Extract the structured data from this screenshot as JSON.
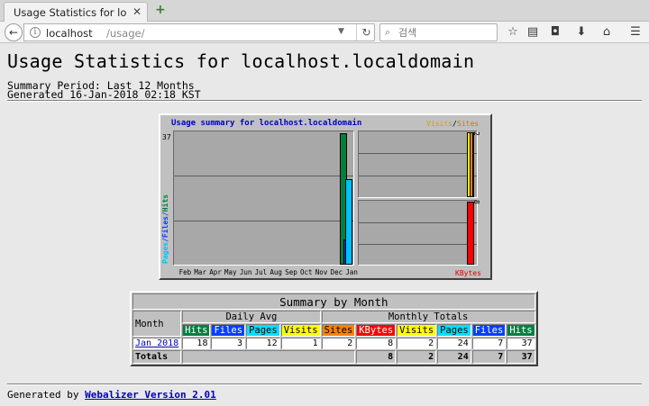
{
  "browser": {
    "tab_title": "Usage Statistics for loc",
    "tab_close": "✕",
    "new_tab": "+",
    "url_host": "localhost",
    "url_path": "/usage/",
    "search_placeholder": "검색"
  },
  "page": {
    "title": "Usage Statistics for localhost.localdomain",
    "summary_period": "Summary Period: Last 12 Months",
    "generated": "Generated 16-Jan-2018 02:18 KST"
  },
  "graph": {
    "title": "Usage summary for localhost.localdomain",
    "legend_visits": "Visits",
    "legend_slash": "/",
    "legend_sites": "Sites",
    "ylabel_pages": "Pages",
    "ylabel_files": "/Files/",
    "ylabel_hits": "Hits",
    "ymax_main": "37",
    "ymax_visits_sites": "2",
    "ymax_kbytes": "8",
    "kbytes_label": "KBytes",
    "months": [
      "Feb",
      "Mar",
      "Apr",
      "May",
      "Jun",
      "Jul",
      "Aug",
      "Sep",
      "Oct",
      "Nov",
      "Dec",
      "Jan"
    ],
    "colors": {
      "hits": "#008040",
      "files": "#0040ff",
      "pages": "#00c0ff",
      "visits": "#ffff00",
      "sites": "#ff8000",
      "kbytes": "#ff0000"
    }
  },
  "chart_data": {
    "type": "bar",
    "categories": [
      "Feb",
      "Mar",
      "Apr",
      "May",
      "Jun",
      "Jul",
      "Aug",
      "Sep",
      "Oct",
      "Nov",
      "Dec",
      "Jan"
    ],
    "series": [
      {
        "name": "Hits",
        "values": [
          0,
          0,
          0,
          0,
          0,
          0,
          0,
          0,
          0,
          0,
          0,
          37
        ]
      },
      {
        "name": "Files",
        "values": [
          0,
          0,
          0,
          0,
          0,
          0,
          0,
          0,
          0,
          0,
          0,
          7
        ]
      },
      {
        "name": "Pages",
        "values": [
          0,
          0,
          0,
          0,
          0,
          0,
          0,
          0,
          0,
          0,
          0,
          24
        ]
      },
      {
        "name": "Visits",
        "values": [
          0,
          0,
          0,
          0,
          0,
          0,
          0,
          0,
          0,
          0,
          0,
          2
        ]
      },
      {
        "name": "Sites",
        "values": [
          0,
          0,
          0,
          0,
          0,
          0,
          0,
          0,
          0,
          0,
          0,
          2
        ]
      },
      {
        "name": "KBytes",
        "values": [
          0,
          0,
          0,
          0,
          0,
          0,
          0,
          0,
          0,
          0,
          0,
          8
        ]
      }
    ],
    "title": "Usage summary for localhost.localdomain",
    "ylim_main": [
      0,
      37
    ],
    "ylim_visits_sites": [
      0,
      2
    ],
    "ylim_kbytes": [
      0,
      8
    ]
  },
  "table": {
    "caption": "Summary by Month",
    "month_header": "Month",
    "daily_avg_header": "Daily Avg",
    "monthly_totals_header": "Monthly Totals",
    "columns": [
      {
        "label": "Hits",
        "bg": "#008040",
        "fg": "#ffffff"
      },
      {
        "label": "Files",
        "bg": "#0040ff",
        "fg": "#ffffff"
      },
      {
        "label": "Pages",
        "bg": "#00e0ff",
        "fg": "#000000"
      },
      {
        "label": "Visits",
        "bg": "#ffff00",
        "fg": "#000000"
      },
      {
        "label": "Sites",
        "bg": "#ff8000",
        "fg": "#000000"
      },
      {
        "label": "KBytes",
        "bg": "#ff0000",
        "fg": "#ffffff"
      },
      {
        "label": "Visits",
        "bg": "#ffff00",
        "fg": "#000000"
      },
      {
        "label": "Pages",
        "bg": "#00e0ff",
        "fg": "#000000"
      },
      {
        "label": "Files",
        "bg": "#0040ff",
        "fg": "#ffffff"
      },
      {
        "label": "Hits",
        "bg": "#008040",
        "fg": "#ffffff"
      }
    ],
    "rows": [
      {
        "month": "Jan 2018",
        "values": [
          "18",
          "3",
          "12",
          "1",
          "2",
          "8",
          "2",
          "24",
          "7",
          "37"
        ]
      }
    ],
    "totals_label": "Totals",
    "totals": [
      "8",
      "2",
      "24",
      "7",
      "37"
    ]
  },
  "footer": {
    "prefix": "Generated by ",
    "link": "Webalizer Version 2.01"
  }
}
